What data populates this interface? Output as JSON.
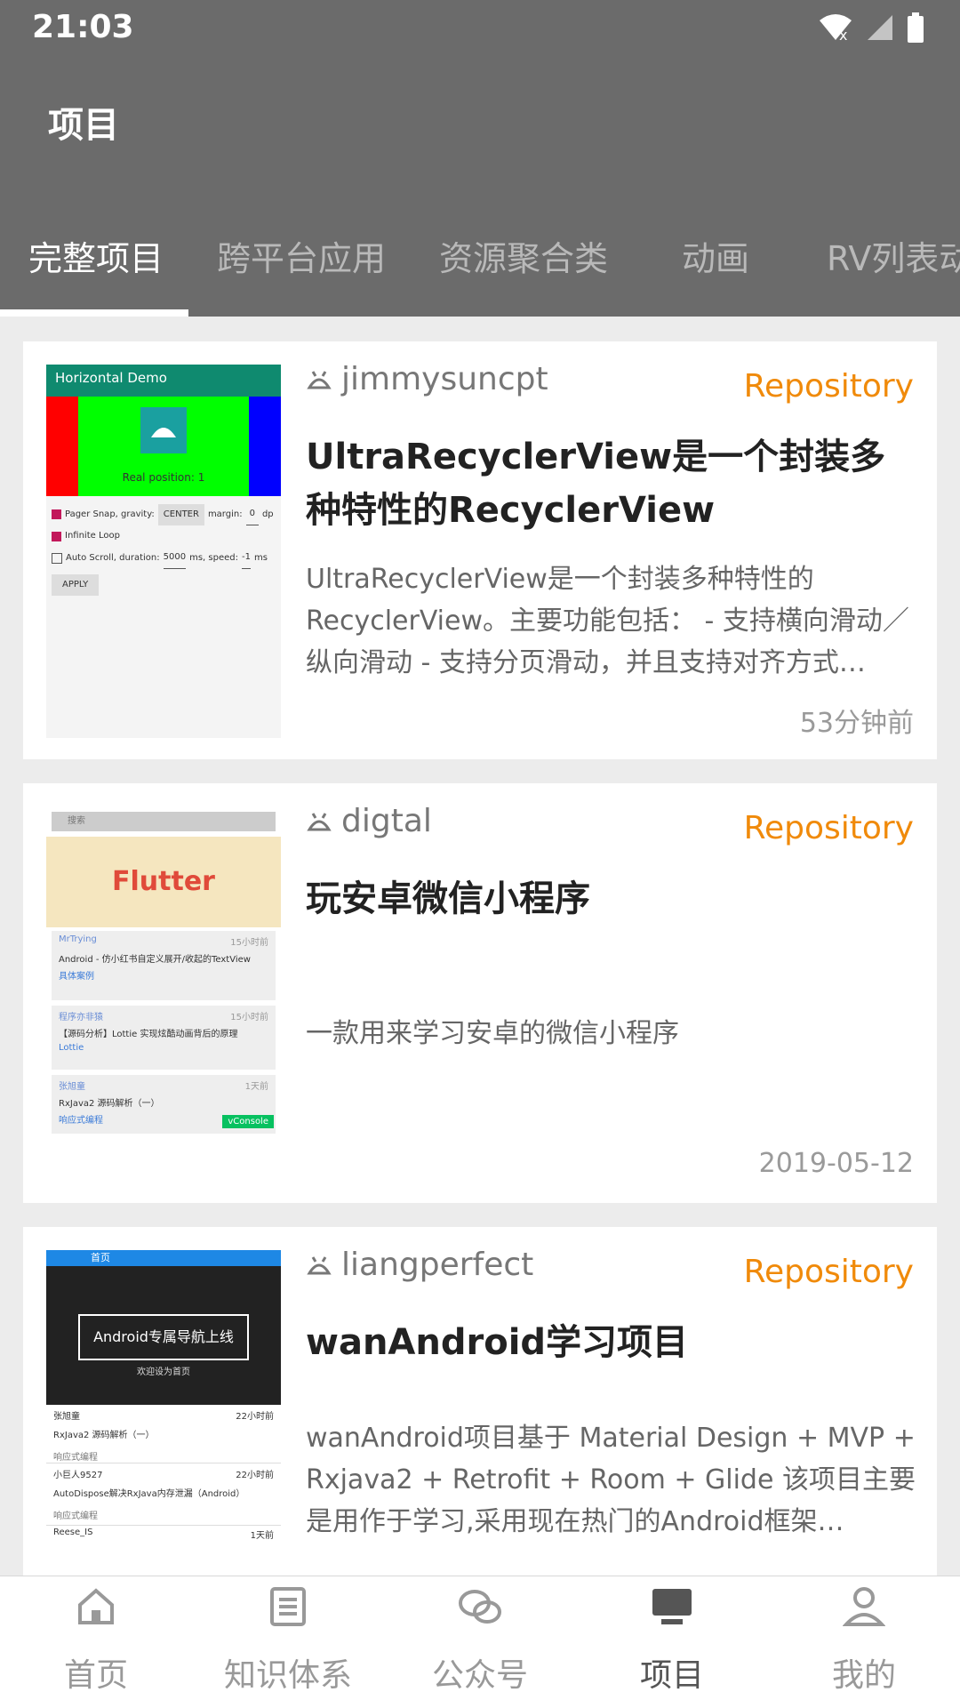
{
  "status": {
    "time": "21:03"
  },
  "app": {
    "title": "项目"
  },
  "tabs": [
    "完整项目",
    "跨平台应用",
    "资源聚合类",
    "动画",
    "RV列表动"
  ],
  "cards": [
    {
      "author": "jimmysuncpt",
      "badge": "Repository",
      "title": "UltraRecyclerView是一个封装多种特性的RecyclerView",
      "desc": "UltraRecyclerView是一个封装多种特性的RecyclerView。主要功能包括： - 支持横向滑动／纵向滑动 - 支持分页滑动，并且支持对齐方式…",
      "time": "53分钟前",
      "thumb": {
        "header": "Horizontal Demo",
        "position": "Real position: 1",
        "opt1": "Pager Snap, gravity:",
        "opt1_btn": "CENTER",
        "opt1_margin": "margin:",
        "opt1_val": "0",
        "opt1_unit": "dp",
        "opt2": "Infinite Loop",
        "opt3": "Auto Scroll, duration:",
        "opt3_val": "5000",
        "opt3_speed": "ms, speed:",
        "opt3_speed_val": "-1",
        "opt3_unit": "ms",
        "apply": "APPLY"
      }
    },
    {
      "author": "digtal",
      "badge": "Repository",
      "title": "玩安卓微信小程序",
      "desc": "一款用来学习安卓的微信小程序",
      "time": "2019-05-12",
      "thumb": {
        "search": "搜索",
        "banner": "Flutter",
        "items": [
          {
            "user": "MrTrying",
            "time": "15小时前",
            "title": "Android - 仿小红书自定义展开/收起的TextView",
            "tag": "具体案例"
          },
          {
            "user": "程序亦非猿",
            "time": "15小时前",
            "title": "【源码分析】Lottie 实现炫酷动画背后的原理",
            "tag": "Lottie"
          },
          {
            "user": "张旭童",
            "time": "1天前",
            "title": "RxJava2 源码解析（一）",
            "tag": "响应式编程"
          }
        ],
        "console": "vConsole"
      }
    },
    {
      "author": "liangperfect",
      "badge": "Repository",
      "title": "wanAndroid学习项目",
      "desc": "wanAndroid项目基于 Material Design + MVP + Rxjava2 + Retrofit + Room + Glide 该项目主要是用作于学习,采用现在热门的Android框架…",
      "thumb": {
        "header": "首页",
        "banner_title": "Android专属导航上线",
        "banner_sub": "欢迎设为首页",
        "items": [
          {
            "user": "张旭童",
            "time": "22小时前",
            "title": "RxJava2 源码解析（一）",
            "tag": "响应式编程"
          },
          {
            "user": "小巨人9527",
            "time": "22小时前",
            "title": "AutoDispose解决RxJava内存泄漏（Android）",
            "tag": "响应式编程"
          }
        ],
        "last_user": "Reese_IS",
        "last_time": "1天前"
      }
    }
  ],
  "bottom_nav": [
    {
      "label": "首页",
      "icon": "home-icon"
    },
    {
      "label": "知识体系",
      "icon": "list-icon"
    },
    {
      "label": "公众号",
      "icon": "chat-icon"
    },
    {
      "label": "项目",
      "icon": "monitor-icon"
    },
    {
      "label": "我的",
      "icon": "person-icon"
    }
  ],
  "colors": {
    "appbar": "#6b6b6b",
    "accent": "#f08a0a",
    "background": "#ececec"
  }
}
